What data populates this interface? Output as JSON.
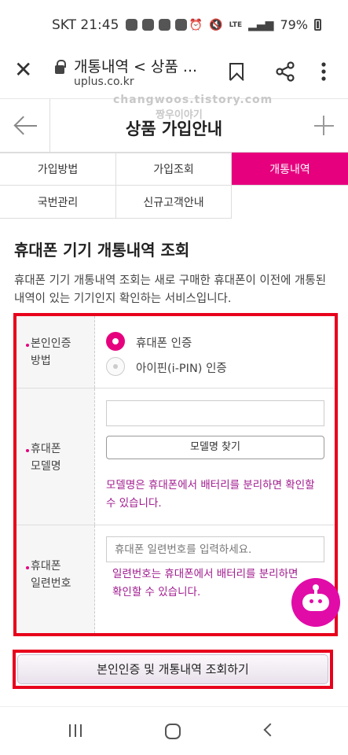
{
  "status_bar": {
    "carrier_time": "SKT 21:45",
    "net_label": "LTE",
    "battery": "79%"
  },
  "browser": {
    "page_title": "개통내역 < 상품 ...",
    "url": "uplus.co.kr"
  },
  "watermark": {
    "line1": "changwoos.tistory.com",
    "line2": "짱우이야기"
  },
  "header": {
    "title": "상품 가입안내"
  },
  "tabs": [
    {
      "label": "가입방법",
      "active": false
    },
    {
      "label": "가입조회",
      "active": false
    },
    {
      "label": "개통내역",
      "active": true
    },
    {
      "label": "국번관리",
      "active": false
    },
    {
      "label": "신규고객안내",
      "active": false
    }
  ],
  "section": {
    "heading": "휴대폰 기기 개통내역 조회",
    "description": "휴대폰 기기 개통내역 조회는 새로 구매한 휴대폰이 이전에 개통된 내역이 있는 기기인지 확인하는 서비스입니다."
  },
  "form": {
    "auth": {
      "label_line1": "본인인증",
      "label_line2": "방법",
      "options": [
        {
          "label": "휴대폰 인증",
          "selected": true
        },
        {
          "label": "아이핀(i-PIN) 인증",
          "selected": false
        }
      ]
    },
    "model": {
      "label_line1": "휴대폰",
      "label_line2": "모델명",
      "value": "",
      "find_button": "모델명 찾기",
      "note": "모델명은 휴대폰에서 배터리를 분리하면 확인할 수 있습니다."
    },
    "serial": {
      "label_line1": "휴대폰",
      "label_line2": "일련번호",
      "placeholder": "휴대폰 일련번호를 입력하세요.",
      "note": "일련번호는 휴대폰에서 배터리를 분리하면 확인할 수 있습니다."
    }
  },
  "submit_label": "본인인증 및 개통내역 조회하기",
  "colors": {
    "accent": "#e6007e",
    "highlight_box": "#e8001c",
    "note_text": "#a01a8e"
  }
}
